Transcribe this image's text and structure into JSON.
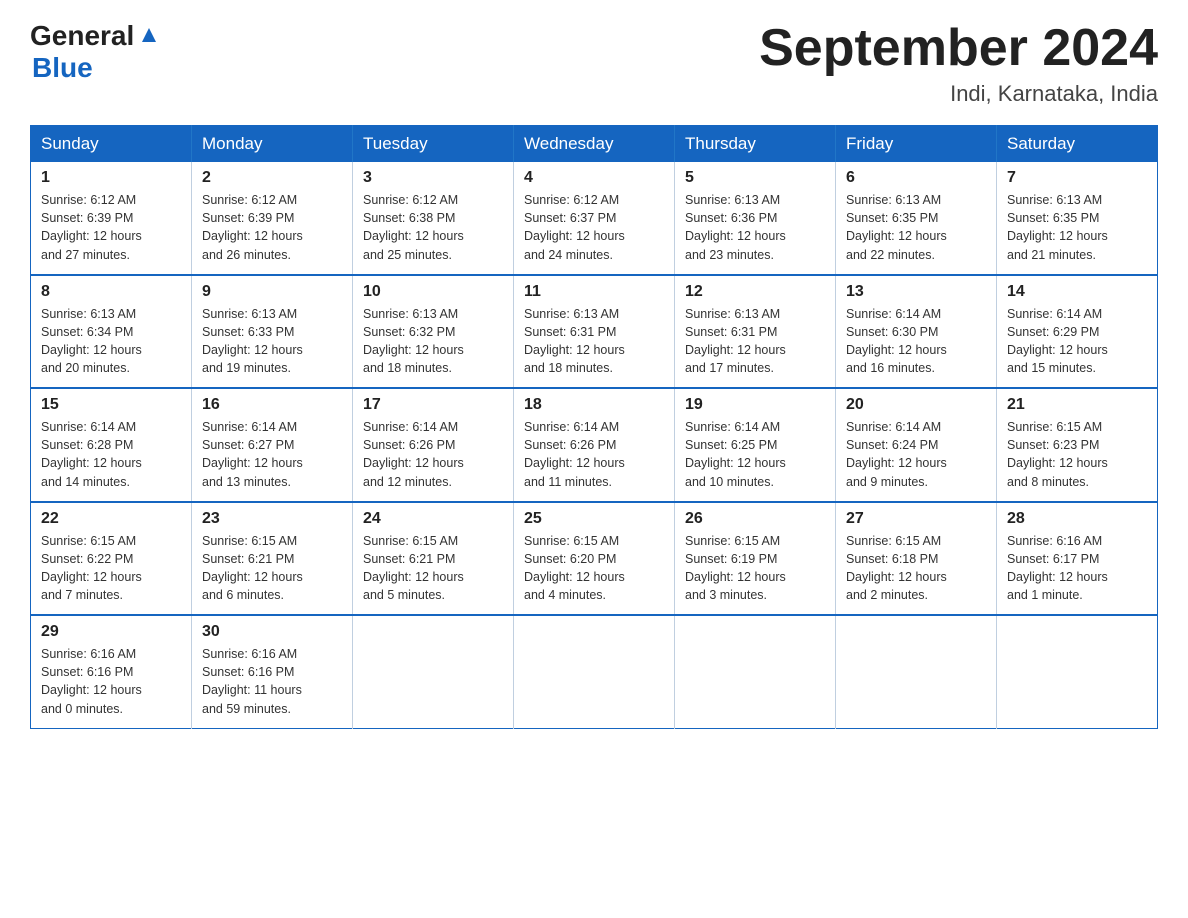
{
  "header": {
    "logo_general": "General",
    "logo_blue": "Blue",
    "title": "September 2024",
    "subtitle": "Indi, Karnataka, India"
  },
  "weekdays": [
    "Sunday",
    "Monday",
    "Tuesday",
    "Wednesday",
    "Thursday",
    "Friday",
    "Saturday"
  ],
  "weeks": [
    [
      {
        "num": "1",
        "sunrise": "6:12 AM",
        "sunset": "6:39 PM",
        "daylight": "12 hours and 27 minutes."
      },
      {
        "num": "2",
        "sunrise": "6:12 AM",
        "sunset": "6:39 PM",
        "daylight": "12 hours and 26 minutes."
      },
      {
        "num": "3",
        "sunrise": "6:12 AM",
        "sunset": "6:38 PM",
        "daylight": "12 hours and 25 minutes."
      },
      {
        "num": "4",
        "sunrise": "6:12 AM",
        "sunset": "6:37 PM",
        "daylight": "12 hours and 24 minutes."
      },
      {
        "num": "5",
        "sunrise": "6:13 AM",
        "sunset": "6:36 PM",
        "daylight": "12 hours and 23 minutes."
      },
      {
        "num": "6",
        "sunrise": "6:13 AM",
        "sunset": "6:35 PM",
        "daylight": "12 hours and 22 minutes."
      },
      {
        "num": "7",
        "sunrise": "6:13 AM",
        "sunset": "6:35 PM",
        "daylight": "12 hours and 21 minutes."
      }
    ],
    [
      {
        "num": "8",
        "sunrise": "6:13 AM",
        "sunset": "6:34 PM",
        "daylight": "12 hours and 20 minutes."
      },
      {
        "num": "9",
        "sunrise": "6:13 AM",
        "sunset": "6:33 PM",
        "daylight": "12 hours and 19 minutes."
      },
      {
        "num": "10",
        "sunrise": "6:13 AM",
        "sunset": "6:32 PM",
        "daylight": "12 hours and 18 minutes."
      },
      {
        "num": "11",
        "sunrise": "6:13 AM",
        "sunset": "6:31 PM",
        "daylight": "12 hours and 18 minutes."
      },
      {
        "num": "12",
        "sunrise": "6:13 AM",
        "sunset": "6:31 PM",
        "daylight": "12 hours and 17 minutes."
      },
      {
        "num": "13",
        "sunrise": "6:14 AM",
        "sunset": "6:30 PM",
        "daylight": "12 hours and 16 minutes."
      },
      {
        "num": "14",
        "sunrise": "6:14 AM",
        "sunset": "6:29 PM",
        "daylight": "12 hours and 15 minutes."
      }
    ],
    [
      {
        "num": "15",
        "sunrise": "6:14 AM",
        "sunset": "6:28 PM",
        "daylight": "12 hours and 14 minutes."
      },
      {
        "num": "16",
        "sunrise": "6:14 AM",
        "sunset": "6:27 PM",
        "daylight": "12 hours and 13 minutes."
      },
      {
        "num": "17",
        "sunrise": "6:14 AM",
        "sunset": "6:26 PM",
        "daylight": "12 hours and 12 minutes."
      },
      {
        "num": "18",
        "sunrise": "6:14 AM",
        "sunset": "6:26 PM",
        "daylight": "12 hours and 11 minutes."
      },
      {
        "num": "19",
        "sunrise": "6:14 AM",
        "sunset": "6:25 PM",
        "daylight": "12 hours and 10 minutes."
      },
      {
        "num": "20",
        "sunrise": "6:14 AM",
        "sunset": "6:24 PM",
        "daylight": "12 hours and 9 minutes."
      },
      {
        "num": "21",
        "sunrise": "6:15 AM",
        "sunset": "6:23 PM",
        "daylight": "12 hours and 8 minutes."
      }
    ],
    [
      {
        "num": "22",
        "sunrise": "6:15 AM",
        "sunset": "6:22 PM",
        "daylight": "12 hours and 7 minutes."
      },
      {
        "num": "23",
        "sunrise": "6:15 AM",
        "sunset": "6:21 PM",
        "daylight": "12 hours and 6 minutes."
      },
      {
        "num": "24",
        "sunrise": "6:15 AM",
        "sunset": "6:21 PM",
        "daylight": "12 hours and 5 minutes."
      },
      {
        "num": "25",
        "sunrise": "6:15 AM",
        "sunset": "6:20 PM",
        "daylight": "12 hours and 4 minutes."
      },
      {
        "num": "26",
        "sunrise": "6:15 AM",
        "sunset": "6:19 PM",
        "daylight": "12 hours and 3 minutes."
      },
      {
        "num": "27",
        "sunrise": "6:15 AM",
        "sunset": "6:18 PM",
        "daylight": "12 hours and 2 minutes."
      },
      {
        "num": "28",
        "sunrise": "6:16 AM",
        "sunset": "6:17 PM",
        "daylight": "12 hours and 1 minute."
      }
    ],
    [
      {
        "num": "29",
        "sunrise": "6:16 AM",
        "sunset": "6:16 PM",
        "daylight": "12 hours and 0 minutes."
      },
      {
        "num": "30",
        "sunrise": "6:16 AM",
        "sunset": "6:16 PM",
        "daylight": "11 hours and 59 minutes."
      },
      null,
      null,
      null,
      null,
      null
    ]
  ],
  "labels": {
    "sunrise": "Sunrise:",
    "sunset": "Sunset:",
    "daylight": "Daylight:"
  }
}
